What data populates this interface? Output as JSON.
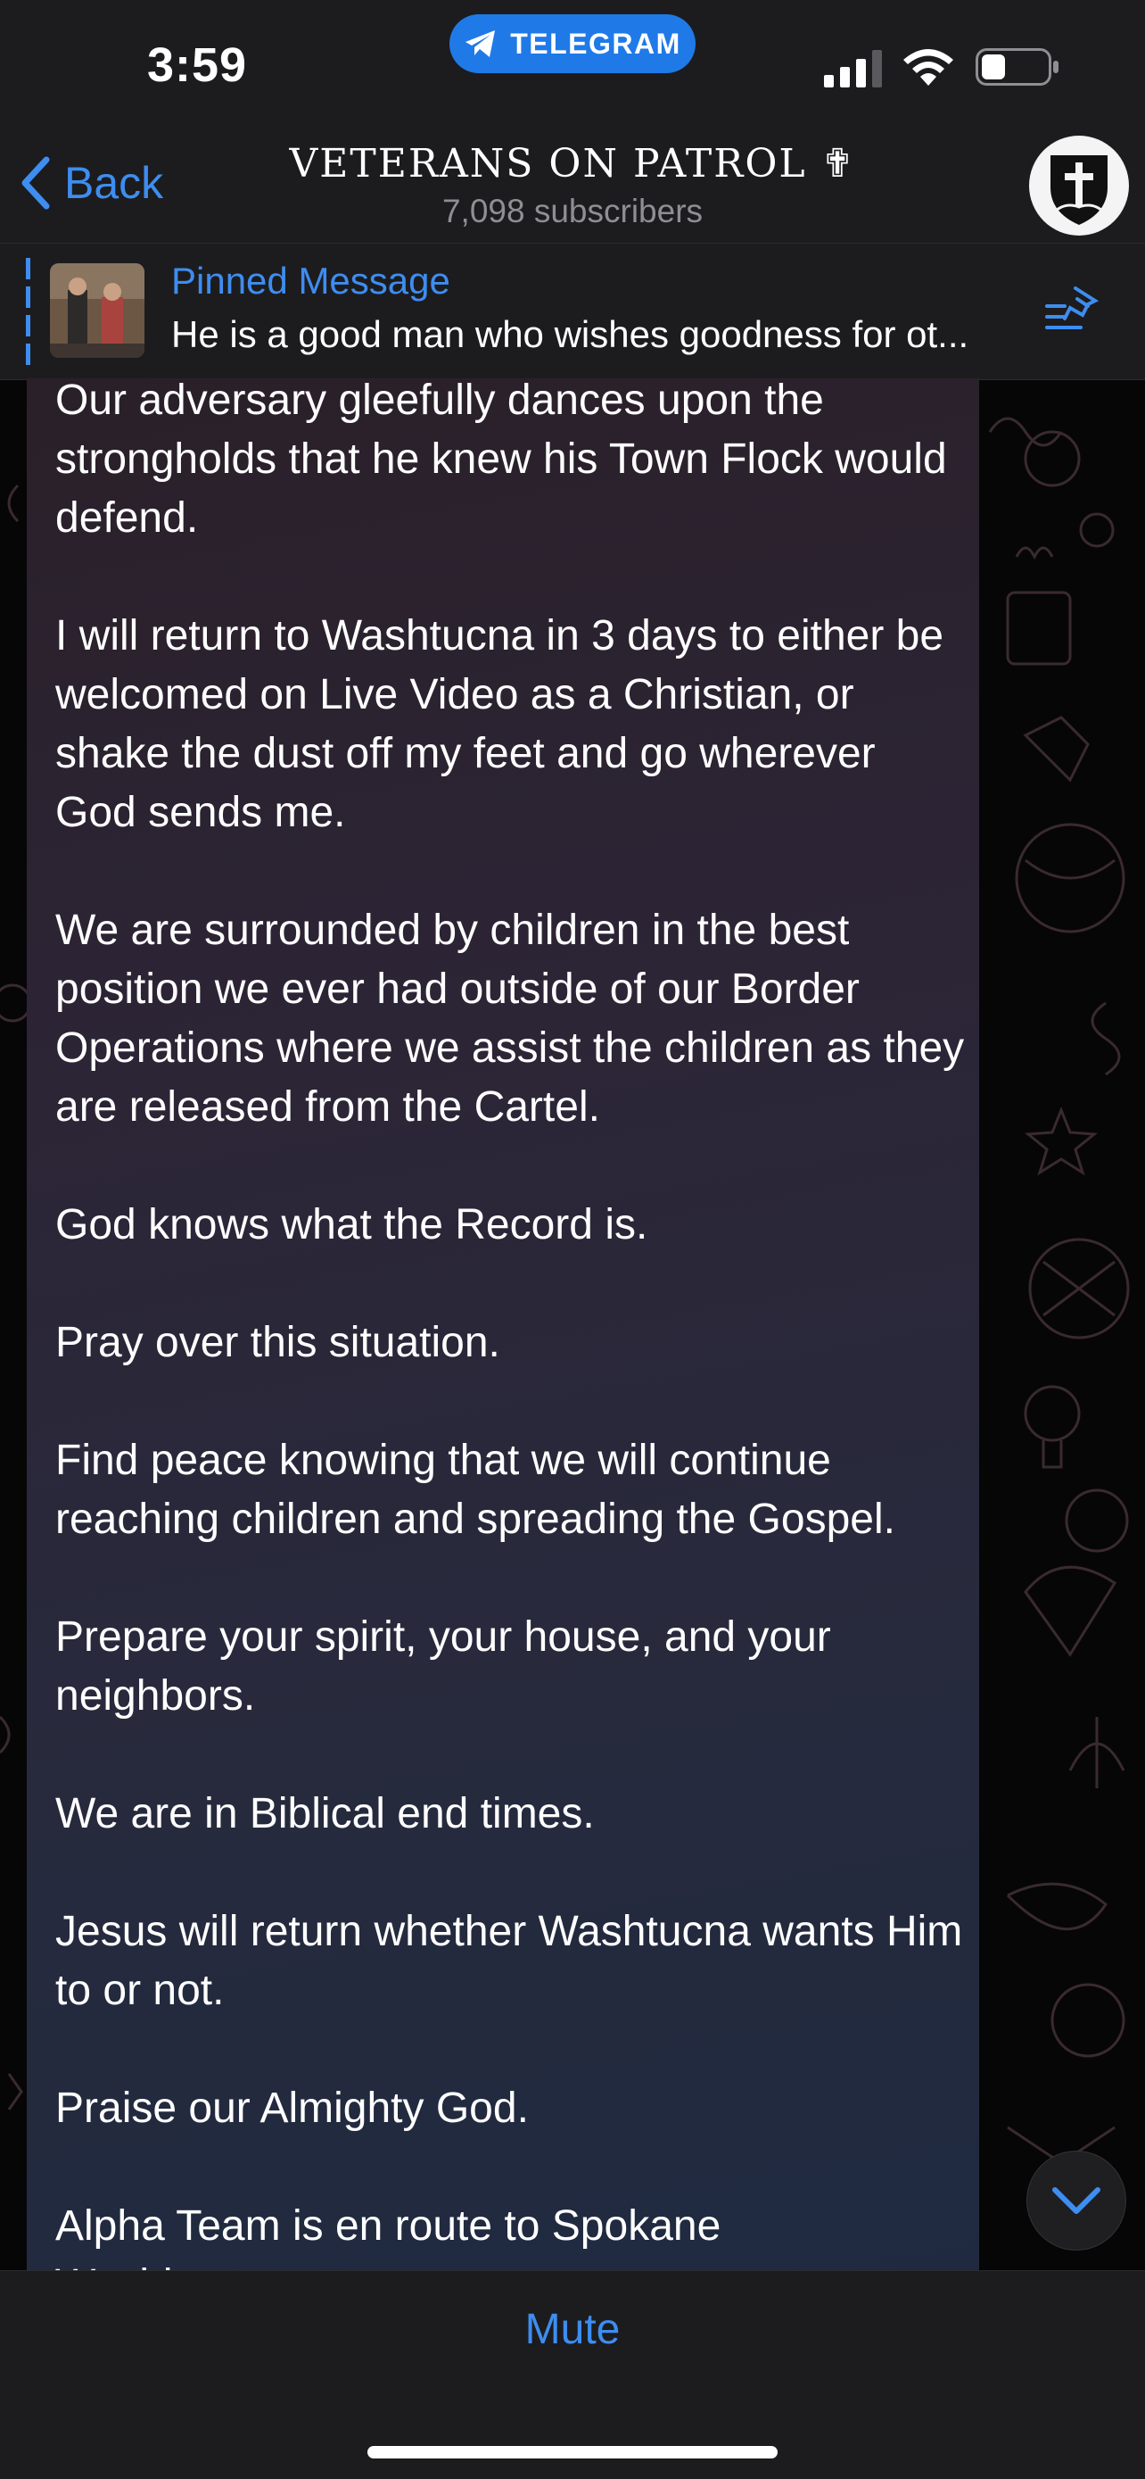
{
  "status_bar": {
    "time": "3:59",
    "app_pill": "TELEGRAM",
    "icons": [
      "signal-icon",
      "wifi-icon",
      "battery-icon"
    ]
  },
  "header": {
    "back_label": "Back",
    "title": "VETERANS ON PATROL ✟",
    "subscribers": "7,098 subscribers"
  },
  "pinned": {
    "label": "Pinned Message",
    "text": "He is a good man who wishes goodness for ot..."
  },
  "message": {
    "paragraphs": [
      "Our adversary gleefully dances upon the strongholds that he knew his Town Flock would defend.",
      "I will return to Washtucna in 3 days to either be welcomed on Live Video as a Christian, or shake the dust off my feet and go wherever God sends me.",
      "We are surrounded by children in the best position we ever had outside of our Border Operations where we assist the children as they are released from the Cartel.",
      "God knows what the Record is.",
      "Pray over this situation.",
      "Find peace knowing that we will continue reaching children and spreading the Gospel.",
      "Prepare your spirit, your house, and your neighbors.",
      "We are in Biblical end times.",
      "Jesus will return whether Washtucna wants Him to or not.",
      "Praise our Almighty God.",
      "Alpha Team is en route to Spokane Washington."
    ]
  },
  "bottom": {
    "mute_label": "Mute"
  },
  "colors": {
    "accent": "#3e8df0",
    "bar_background": "#1c1c1e",
    "telegram_pill": "#1f7ae8"
  }
}
